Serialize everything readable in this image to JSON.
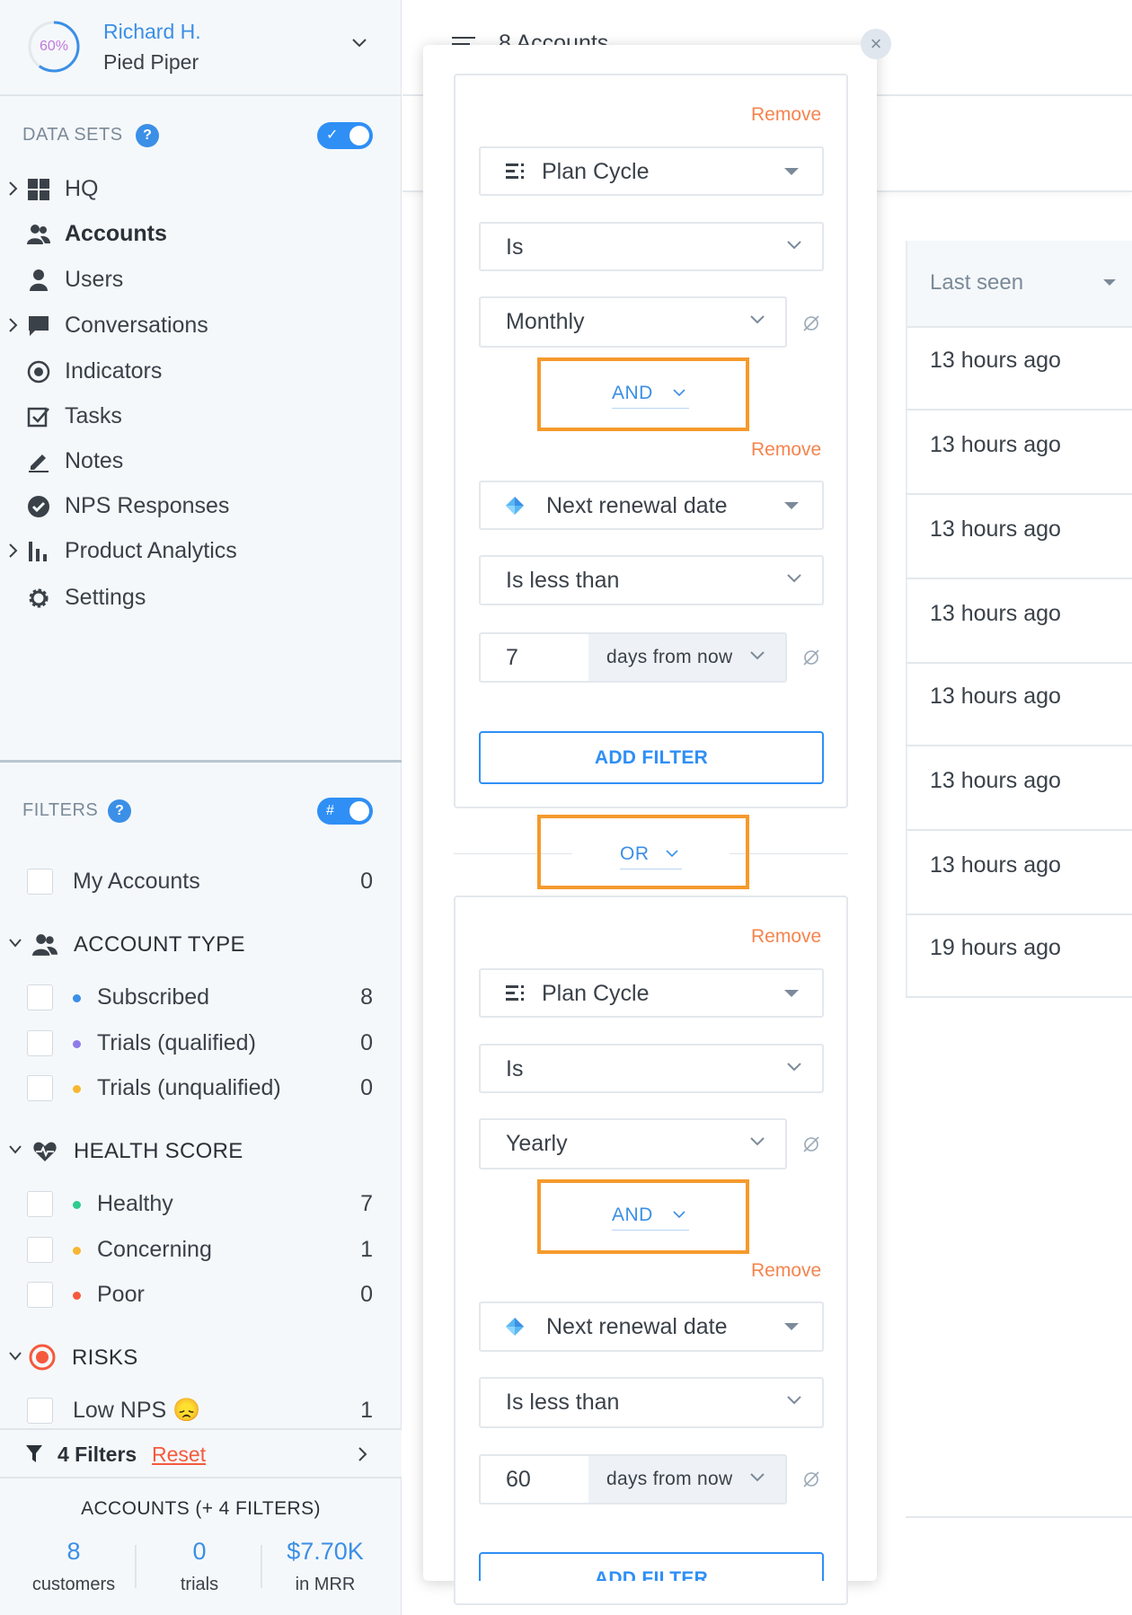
{
  "profile": {
    "progress_label": "60%",
    "progress": 0.6,
    "user_name": "Richard H.",
    "company": "Pied Piper"
  },
  "datasets": {
    "title": "DATA SETS",
    "help": "?",
    "items": [
      {
        "label": "HQ",
        "icon": "grid-icon",
        "expandable": true
      },
      {
        "label": "Accounts",
        "icon": "people-icon",
        "active": true
      },
      {
        "label": "Users",
        "icon": "user-icon"
      },
      {
        "label": "Conversations",
        "icon": "chat-icon",
        "expandable": true
      },
      {
        "label": "Indicators",
        "icon": "target-icon"
      },
      {
        "label": "Tasks",
        "icon": "task-check-icon"
      },
      {
        "label": "Notes",
        "icon": "pencil-icon"
      },
      {
        "label": "NPS Responses",
        "icon": "check-circle-icon"
      },
      {
        "label": "Product Analytics",
        "icon": "bar-chart-icon",
        "expandable": true
      },
      {
        "label": "Settings",
        "icon": "gear-icon"
      }
    ]
  },
  "filters": {
    "title": "FILTERS",
    "help": "?",
    "toggle_label": "#",
    "my_accounts": {
      "label": "My Accounts",
      "count": "0"
    },
    "account_type": {
      "title": "ACCOUNT TYPE",
      "items": [
        {
          "label": "Subscribed",
          "count": "8",
          "color": "#3b8fe6"
        },
        {
          "label": "Trials (qualified)",
          "count": "0",
          "color": "#8f7ce8"
        },
        {
          "label": "Trials (unqualified)",
          "count": "0",
          "color": "#f7b731"
        }
      ]
    },
    "health_score": {
      "title": "HEALTH SCORE",
      "items": [
        {
          "label": "Healthy",
          "count": "7",
          "color": "#2ecc8f"
        },
        {
          "label": "Concerning",
          "count": "1",
          "color": "#f7b731"
        },
        {
          "label": "Poor",
          "count": "0",
          "color": "#f5593d"
        }
      ]
    },
    "risks": {
      "title": "RISKS",
      "items": [
        {
          "label": "Low NPS 😞",
          "count": "1"
        }
      ]
    },
    "bar": {
      "count_label": "4 Filters",
      "reset": "Reset"
    }
  },
  "summary": {
    "title": "ACCOUNTS (+ 4 FILTERS)",
    "stats": [
      {
        "value": "8",
        "label": "customers"
      },
      {
        "value": "0",
        "label": "trials"
      },
      {
        "value": "$7.70K",
        "label": "in MRR"
      }
    ]
  },
  "main": {
    "title": "8 Accounts",
    "column": "Last seen",
    "rows": [
      "13 hours ago",
      "13 hours ago",
      "13 hours ago",
      "13 hours ago",
      "13 hours ago",
      "13 hours ago",
      "13 hours ago",
      "19 hours ago"
    ]
  },
  "popover": {
    "remove": "Remove",
    "add_filter": "ADD FILTER",
    "or": "OR",
    "and": "AND",
    "groups": [
      {
        "f1": {
          "field": "Plan Cycle",
          "op": "Is",
          "value": "Monthly"
        },
        "f2": {
          "field": "Next renewal date",
          "op": "Is less than",
          "number": "7",
          "unit": "days from now"
        }
      },
      {
        "f1": {
          "field": "Plan Cycle",
          "op": "Is",
          "value": "Yearly"
        },
        "f2": {
          "field": "Next renewal date",
          "op": "Is less than",
          "number": "60",
          "unit": "days from now"
        }
      }
    ]
  },
  "colors": {
    "accent": "#2f8ff5",
    "remove": "#f5844e",
    "highlight": "#f59a2c"
  }
}
